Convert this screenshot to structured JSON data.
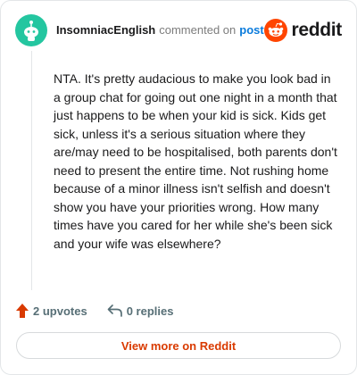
{
  "header": {
    "author": "InsomniacEnglish",
    "action_text": "commented on",
    "post_link": "post",
    "brand": "reddit"
  },
  "comment": {
    "body": "NTA. It's pretty audacious to make you look bad in a group chat for going out one night in a month that just happens to be when your kid is sick. Kids get sick, unless it's a serious situation where they are/may need to be hospitalised, both parents don't need to present the entire time. Not rushing home because of a minor illness isn't selfish and doesn't show you have your priorities wrong. How many times have you cared for her while she's been sick and your wife was elsewhere?"
  },
  "actions": {
    "upvotes": "2 upvotes",
    "replies": "0 replies"
  },
  "footer": {
    "view_more": "View more on Reddit"
  },
  "colors": {
    "avatar": "#24c6a0",
    "brand_orange": "#ff4500",
    "link_blue": "#0a7bdc",
    "view_more_text": "#d93a00"
  },
  "icons": {
    "avatar": "snoo-avatar-icon",
    "brand": "reddit-logo-icon",
    "upvote": "upvote-arrow-icon",
    "reply": "reply-arrow-icon"
  }
}
